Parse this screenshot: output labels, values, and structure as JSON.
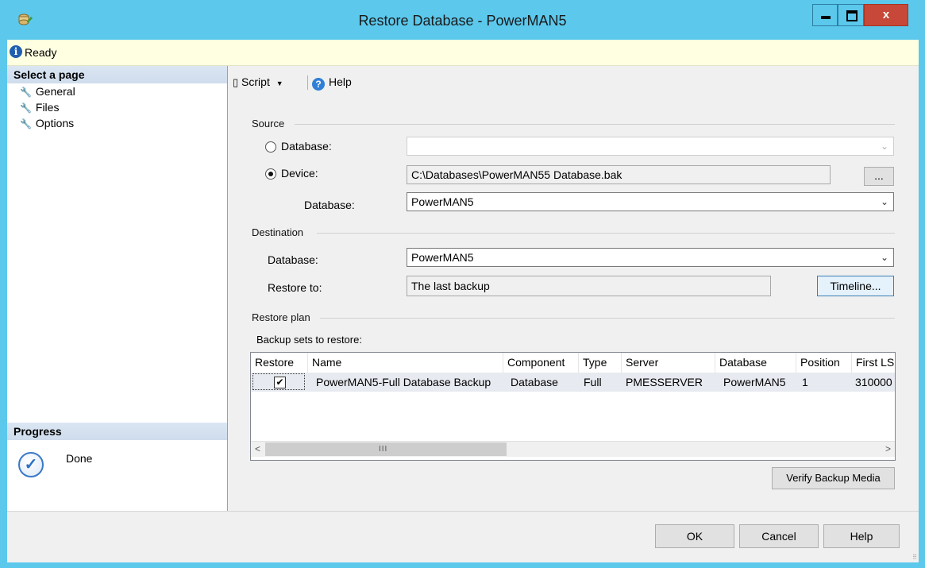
{
  "window": {
    "title": "Restore Database - PowerMAN5",
    "close_glyph": "x"
  },
  "status": {
    "icon": "info-icon",
    "text": "Ready"
  },
  "left_pane": {
    "select_page_label": "Select a page",
    "pages": [
      {
        "label": "General",
        "icon": "wrench-icon",
        "selected": true
      },
      {
        "label": "Files",
        "icon": "wrench-icon",
        "selected": false
      },
      {
        "label": "Options",
        "icon": "wrench-icon",
        "selected": false
      }
    ],
    "progress_label": "Progress",
    "progress_status": "Done"
  },
  "toolbar": {
    "script_label": "Script",
    "help_label": "Help"
  },
  "source": {
    "section_label": "Source",
    "database_radio_label": "Database:",
    "database_value": "",
    "device_radio_label": "Device:",
    "device_value": "C:\\Databases\\PowerMAN55 Database.bak",
    "browse_label": "...",
    "database_label": "Database:",
    "database_select_value": "PowerMAN5",
    "selected_option": "device"
  },
  "destination": {
    "section_label": "Destination",
    "database_label": "Database:",
    "database_value": "PowerMAN5",
    "restore_to_label": "Restore to:",
    "restore_to_value": "The last backup",
    "timeline_label": "Timeline..."
  },
  "restore_plan": {
    "section_label": "Restore plan",
    "backup_sets_label": "Backup sets to restore:",
    "columns": [
      "Restore",
      "Name",
      "Component",
      "Type",
      "Server",
      "Database",
      "Position",
      "First LS"
    ],
    "rows": [
      {
        "restore": true,
        "name": "PowerMAN5-Full Database Backup",
        "component": "Database",
        "type": "Full",
        "server": "PMESSERVER",
        "database": "PowerMAN5",
        "position": "1",
        "first_lsn": "310000"
      }
    ],
    "scroll_left": "<",
    "scroll_right": ">",
    "scroll_grip": "III",
    "verify_label": "Verify Backup Media"
  },
  "footer": {
    "ok_label": "OK",
    "cancel_label": "Cancel",
    "help_label": "Help"
  },
  "colors": {
    "title_bar": "#5bc8ec",
    "close_button": "#c74838",
    "status_bar": "#ffffe1",
    "pane_header": "#d4e0ef"
  }
}
